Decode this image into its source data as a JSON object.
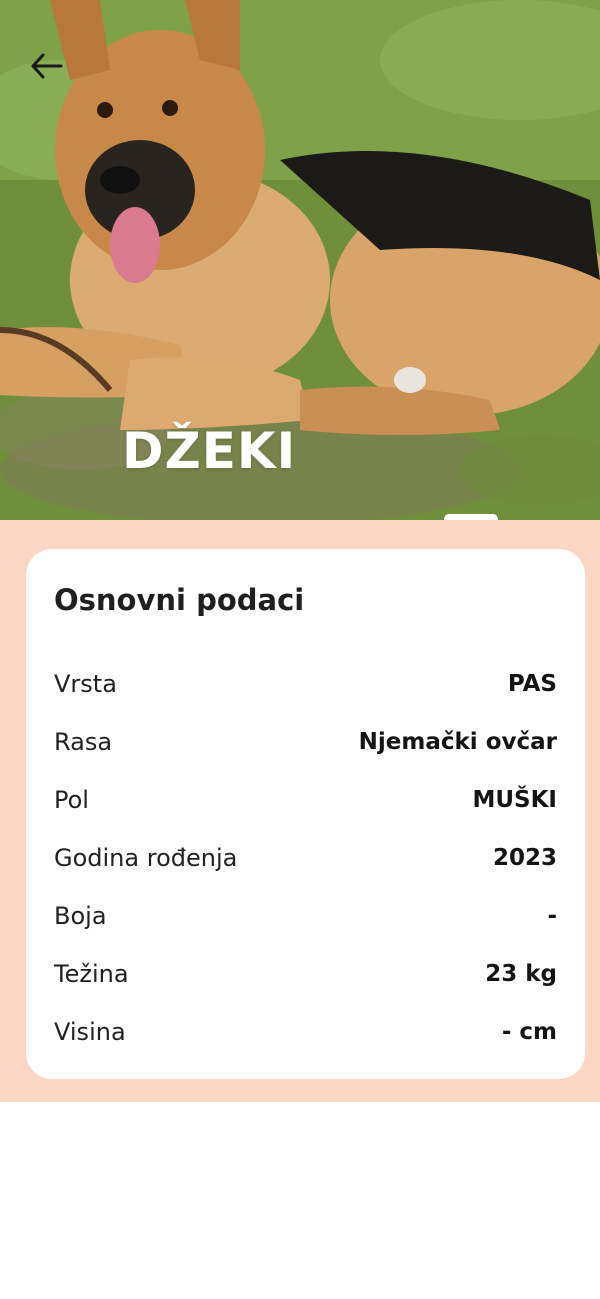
{
  "pet": {
    "name": "DŽEKI"
  },
  "info": {
    "title": "Osnovni podaci",
    "rows": [
      {
        "label": "Vrsta",
        "value": "PAS"
      },
      {
        "label": "Rasa",
        "value": "Njemački ovčar"
      },
      {
        "label": "Pol",
        "value": "MUŠKI"
      },
      {
        "label": "Godina rođenja",
        "value": "2023"
      },
      {
        "label": "Boja",
        "value": "-"
      },
      {
        "label": "Težina",
        "value": "23 kg"
      },
      {
        "label": "Visina",
        "value": "- cm"
      }
    ]
  },
  "icons": {
    "back": "arrow-left-icon"
  },
  "colors": {
    "section_background": "#f9d7c4",
    "card_background": "#ffffff",
    "name_text": "#ffffff"
  }
}
